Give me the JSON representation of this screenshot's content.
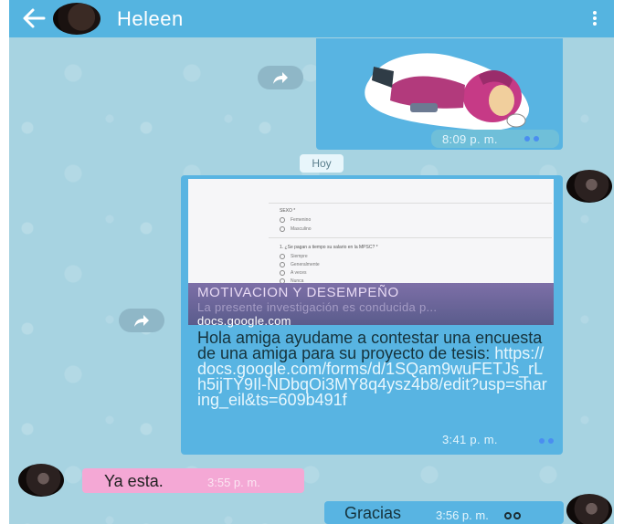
{
  "header": {
    "contact_name": "Heleen",
    "back_icon": "arrow-left-icon",
    "menu_icon": "vertical-dots-icon"
  },
  "messages": {
    "sticker": {
      "time": "8:09 p. m.",
      "status_icon": "double-tick-icon"
    },
    "date_divider": "Hoy",
    "link_message": {
      "preview_title": "MOTIVACION Y DESEMPEÑO",
      "preview_description": "La presente investigación es conducida p...",
      "preview_domain": "docs.google.com",
      "body_text": "Hola amiga ayudame a contestar una encuesta de una amiga para su proyecto de tesis: ",
      "body_link": "https://docs.google.com/forms/d/1SQam9wuFETJs_rLh5ijTY9Il-NDbqOi3MY8q4ysz4b8/edit?usp=sharing_eil&ts=609b491f",
      "time": "3:41 p. m.",
      "status_icon": "double-tick-icon"
    },
    "incoming": {
      "text": "Ya esta.",
      "time": "3:55 p. m."
    },
    "outgoing_last": {
      "text": "Gracias",
      "time": "3:56 p. m.",
      "status_icon": "double-tick-icon"
    }
  },
  "colors": {
    "header": "#55b4e0",
    "chat_background": "#a7d3e1",
    "outgoing_bubble": "#58b4e2",
    "incoming_bubble": "#f4a8d5"
  }
}
